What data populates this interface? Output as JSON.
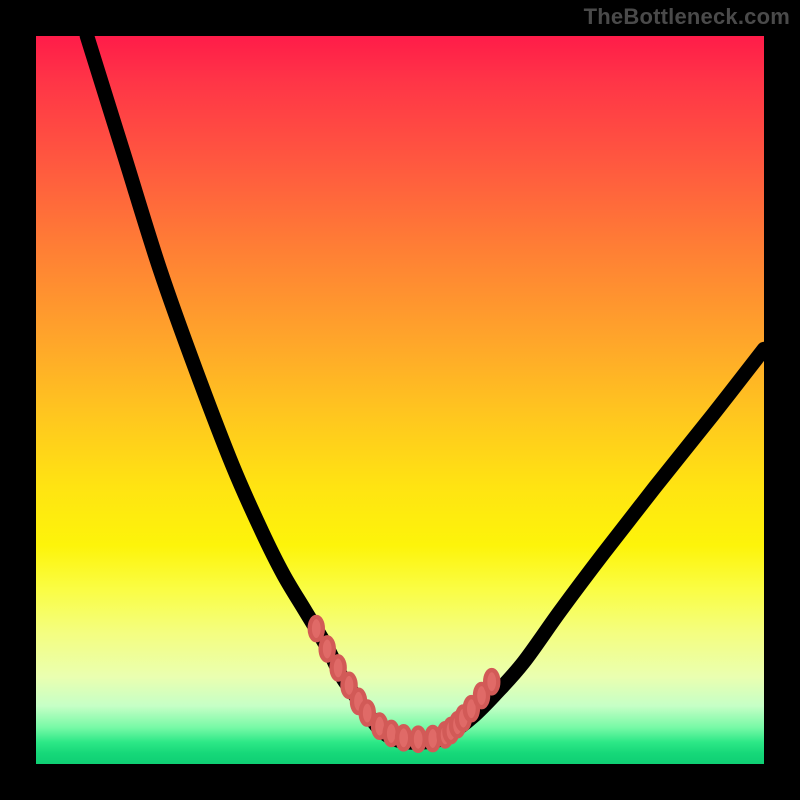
{
  "attribution": "TheBottleneck.com",
  "colors": {
    "background": "#000000",
    "curve": "#000000",
    "marker_fill": "#e06a67",
    "marker_stroke": "#d25a57",
    "gradient_stops": [
      "#ff1c49",
      "#ff3447",
      "#ff5a3f",
      "#ff8134",
      "#ffa62a",
      "#ffc61f",
      "#ffe412",
      "#fdf40a",
      "#fafd44",
      "#f4fe80",
      "#eaffb0",
      "#c6ffc6",
      "#77f9a6",
      "#2de887",
      "#16d879",
      "#0fcf74"
    ]
  },
  "chart_data": {
    "type": "line",
    "title": "",
    "xlabel": "",
    "ylabel": "",
    "xlim": [
      0,
      100
    ],
    "ylim": [
      0,
      100
    ],
    "grid": false,
    "legend": false,
    "series": [
      {
        "name": "curve",
        "x": [
          7,
          12,
          17,
          22,
          27,
          31,
          34,
          37,
          40,
          42,
          44.5,
          47,
          49,
          51,
          53,
          55,
          57,
          60,
          63,
          67,
          72,
          78,
          85,
          93,
          100
        ],
        "values": [
          100,
          84,
          68,
          54,
          41,
          32,
          26,
          21,
          16,
          12,
          8.5,
          5,
          3.5,
          3,
          3,
          3.2,
          4.2,
          6.5,
          9.5,
          14,
          21,
          29,
          38,
          48,
          57
        ]
      }
    ],
    "markers": {
      "name": "dots",
      "x": [
        38.5,
        40,
        41.5,
        43,
        44.3,
        45.5,
        47.2,
        48.8,
        50.5,
        52.5,
        54.5,
        56.2,
        57.0,
        57.9,
        58.7,
        59.8,
        61.2,
        62.6
      ],
      "values": [
        18.6,
        15.8,
        13.2,
        10.8,
        8.6,
        7.0,
        5.2,
        4.2,
        3.6,
        3.4,
        3.5,
        4.0,
        4.6,
        5.4,
        6.3,
        7.6,
        9.4,
        11.3
      ]
    },
    "marker_style": {
      "shape": "ellipse",
      "rx_pct": 0.9,
      "ry_pct": 1.6
    }
  }
}
